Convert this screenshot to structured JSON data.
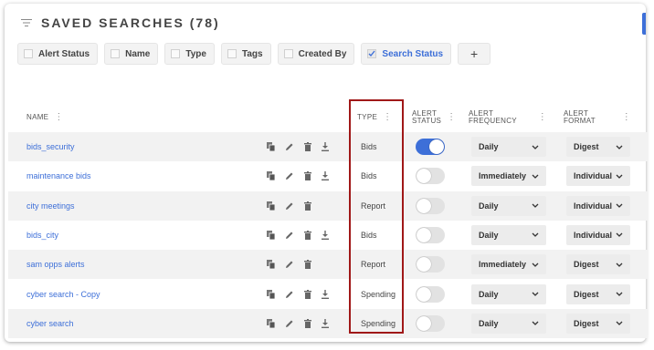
{
  "page": {
    "title": "SAVED SEARCHES (78)"
  },
  "filters": {
    "chips": [
      {
        "label": "Alert Status",
        "checked": false
      },
      {
        "label": "Name",
        "checked": false
      },
      {
        "label": "Type",
        "checked": false
      },
      {
        "label": "Tags",
        "checked": false
      },
      {
        "label": "Created By",
        "checked": false
      },
      {
        "label": "Search Status",
        "checked": true
      }
    ],
    "add_label": "+"
  },
  "table": {
    "headers": {
      "name": "NAME",
      "type": "TYPE",
      "alert_status": "ALERT STATUS",
      "alert_status_l1": "ALERT",
      "alert_status_l2": "STATUS",
      "alert_frequency_l1": "ALERT",
      "alert_frequency_l2": "FREQUENCY",
      "alert_format_l1": "ALERT",
      "alert_format_l2": "FORMAT"
    },
    "rows": [
      {
        "name": "bids_security",
        "type": "Bids",
        "alert_on": true,
        "frequency": "Daily",
        "format": "Digest",
        "has_download": true
      },
      {
        "name": "maintenance bids",
        "type": "Bids",
        "alert_on": false,
        "frequency": "Immediately",
        "format": "Individual",
        "has_download": true
      },
      {
        "name": "city meetings",
        "type": "Report",
        "alert_on": false,
        "frequency": "Daily",
        "format": "Individual",
        "has_download": false
      },
      {
        "name": "bids_city",
        "type": "Bids",
        "alert_on": false,
        "frequency": "Daily",
        "format": "Individual",
        "has_download": true
      },
      {
        "name": "sam opps alerts",
        "type": "Report",
        "alert_on": false,
        "frequency": "Immediately",
        "format": "Digest",
        "has_download": false
      },
      {
        "name": "cyber search - Copy",
        "type": "Spending",
        "alert_on": false,
        "frequency": "Daily",
        "format": "Digest",
        "has_download": true
      },
      {
        "name": "cyber search",
        "type": "Spending",
        "alert_on": false,
        "frequency": "Daily",
        "format": "Digest",
        "has_download": true
      }
    ]
  },
  "colors": {
    "accent": "#3d6fd8",
    "highlight_box": "#a01818"
  },
  "icons": [
    "menu-icon",
    "copy-icon",
    "edit-icon",
    "delete-icon",
    "download-icon",
    "chevron-down-icon",
    "kebab-icon"
  ]
}
